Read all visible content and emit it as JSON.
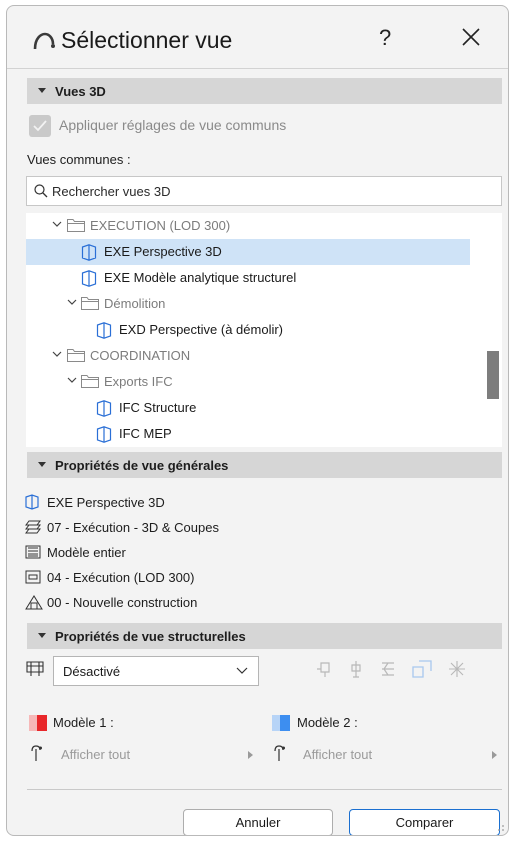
{
  "window": {
    "title": "Sélectionner vue",
    "help_label": "?"
  },
  "views3d": {
    "header": "Vues 3D",
    "apply_common_label": "Appliquer réglages de vue communs",
    "common_views_label": "Vues communes :",
    "search_placeholder": "Rechercher vues 3D",
    "tree": [
      {
        "label": "EXECUTION (LOD 300)",
        "type": "folder",
        "expanded": true,
        "depth": 0
      },
      {
        "label": "EXE Perspective 3D",
        "type": "view",
        "selected": true,
        "depth": 1
      },
      {
        "label": "EXE Modèle analytique structurel",
        "type": "view",
        "depth": 1
      },
      {
        "label": "Démolition",
        "type": "folder",
        "expanded": true,
        "depth": 1
      },
      {
        "label": "EXD Perspective (à démolir)",
        "type": "view",
        "depth": 2
      },
      {
        "label": "COORDINATION",
        "type": "folder",
        "expanded": true,
        "depth": 0
      },
      {
        "label": "Exports IFC",
        "type": "folder",
        "expanded": true,
        "depth": 1
      },
      {
        "label": "IFC Structure",
        "type": "view",
        "depth": 2
      },
      {
        "label": "IFC MEP",
        "type": "view",
        "depth": 2
      }
    ]
  },
  "general_props": {
    "header": "Propriétés de vue générales",
    "items": [
      {
        "icon": "perspective-view-icon",
        "text": "EXE Perspective 3D"
      },
      {
        "icon": "layer-combination-icon",
        "text": "07 - Exécution - 3D & Coupes"
      },
      {
        "icon": "model-view-icon",
        "text": "Modèle entier"
      },
      {
        "icon": "pen-set-icon",
        "text": "04 - Exécution (LOD 300)"
      },
      {
        "icon": "renovation-filter-icon",
        "text": "00 - Nouvelle construction"
      }
    ]
  },
  "struct_props": {
    "header": "Propriétés de vue structurelles",
    "dropdown_value": "Désactivé",
    "model1_label": "Modèle 1 :",
    "model2_label": "Modèle 2 :",
    "model1_color": "#e8272a",
    "model2_color": "#3d8ef0",
    "filter1": "Afficher tout",
    "filter2": "Afficher tout"
  },
  "buttons": {
    "cancel": "Annuler",
    "compare": "Comparer"
  },
  "colors": {
    "selection": "#cfe3f7",
    "accent": "#1a6fd0",
    "view_icon": "#2a6fd6"
  }
}
